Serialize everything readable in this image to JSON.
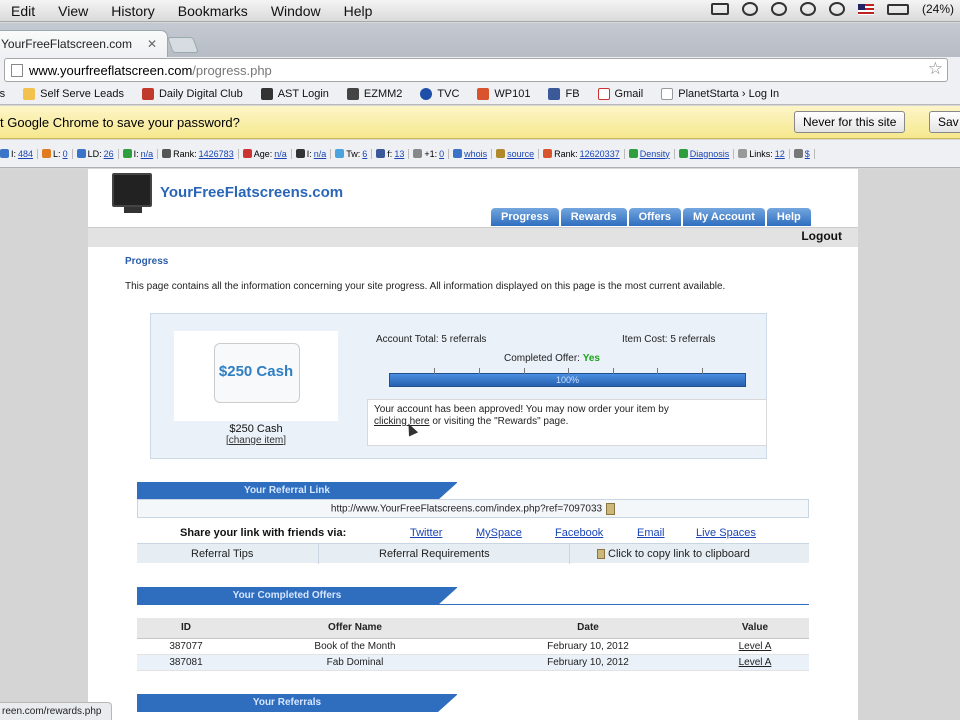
{
  "menubar": {
    "items": [
      "Edit",
      "View",
      "History",
      "Bookmarks",
      "Window",
      "Help"
    ],
    "battery_text": "(24%)"
  },
  "browser": {
    "tab_title": "YourFreeFlatscreen.com",
    "url_host": "www.yourfreeflatscreen.com",
    "url_path": "/progress.php",
    "bookmarks": [
      "Self Serve Leads",
      "Daily Digital Club",
      "AST Login",
      "EZMM2",
      "TVC",
      "WP101",
      "FB",
      "Gmail",
      "PlanetStarta › Log In"
    ],
    "bookmark_first_partial": "rs",
    "infobar_message": "t Google Chrome to save your password?",
    "infobar_never": "Never for this site",
    "infobar_save": "Sav",
    "status_url": "reen.com/rewards.php"
  },
  "seobar": {
    "items": [
      {
        "label": "I:",
        "value": "484"
      },
      {
        "label": "L:",
        "value": "0"
      },
      {
        "label": "LD:",
        "value": "26"
      },
      {
        "label": "I:",
        "value": "n/a"
      },
      {
        "label": "Rank:",
        "value": "1426783"
      },
      {
        "label": "Age:",
        "value": "n/a"
      },
      {
        "label": "I:",
        "value": "n/a"
      },
      {
        "label": "Tw:",
        "value": "6"
      },
      {
        "label": "f:",
        "value": "13"
      },
      {
        "label": "+1:",
        "value": "0"
      },
      {
        "label": "",
        "value": "whois"
      },
      {
        "label": "",
        "value": "source"
      },
      {
        "label": "Rank:",
        "value": "12620337"
      },
      {
        "label": "",
        "value": "Density"
      },
      {
        "label": "",
        "value": "Diagnosis"
      },
      {
        "label": "Links:",
        "value": "12"
      },
      {
        "label": "",
        "value": "$"
      }
    ]
  },
  "site": {
    "logo_text": "YourFreeFlatscreens.com",
    "nav": [
      "Progress",
      "Rewards",
      "Offers",
      "My Account",
      "Help"
    ],
    "logout": "Logout",
    "section_title": "Progress",
    "intro": "This page contains all the information concerning your site progress. All information displayed on this page is the most current available.",
    "item": {
      "price_label": "$250 Cash",
      "name": "$250 Cash",
      "change_link": "change item"
    },
    "stats": {
      "account_total": "Account Total: 5 referrals",
      "item_cost": "Item Cost: 5 referrals",
      "completed_label": "Completed Offer:",
      "completed_value": "Yes",
      "progress_percent": 100,
      "progress_text": "100%"
    },
    "approval": {
      "text_before": "Your account has been approved! You may now order your item by",
      "link": "clicking here",
      "text_after": " or visiting the \"Rewards\" page."
    },
    "referral": {
      "heading": "Your Referral Link",
      "url": "http://www.YourFreeFlatscreens.com/index.php?ref=7097033",
      "share_label": "Share your link with friends via:",
      "share_links": [
        "Twitter",
        "MySpace",
        "Facebook",
        "Email",
        "Live Spaces"
      ],
      "tips": "Referral Tips",
      "requirements": "Referral Requirements",
      "copy": "Click to copy link to clipboard"
    },
    "completed_offers": {
      "heading": "Your Completed Offers",
      "columns": [
        "ID",
        "Offer Name",
        "Date",
        "Value"
      ],
      "rows": [
        {
          "id": "387077",
          "name": "Book of the Month",
          "date": "February 10, 2012",
          "value": "Level A"
        },
        {
          "id": "387081",
          "name": "Fab Dominal",
          "date": "February 10, 2012",
          "value": "Level A"
        }
      ]
    },
    "referrals_heading": "Your Referrals"
  },
  "colors": {
    "brand_blue": "#2f6ebf",
    "link_blue": "#1b45b5",
    "yes_green": "#19a319"
  }
}
